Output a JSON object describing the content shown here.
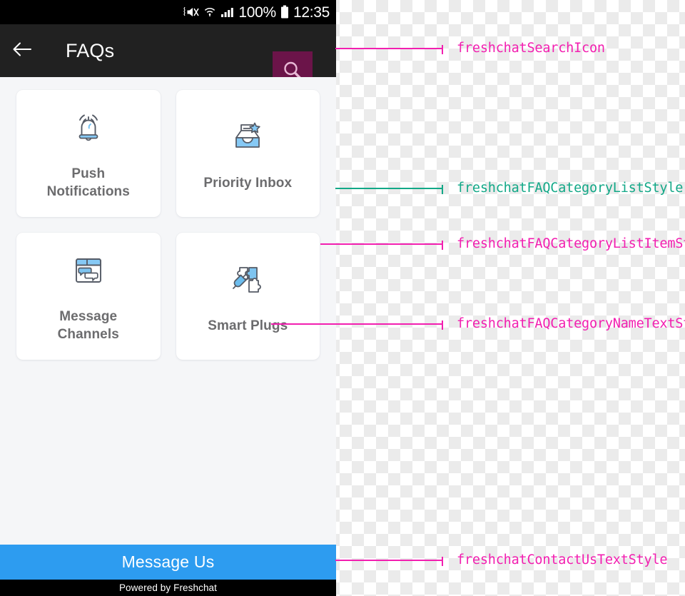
{
  "status_bar": {
    "icons": [
      "vibrate-mute-icon",
      "wifi-icon",
      "signal-icon",
      "battery-icon"
    ],
    "battery_percent": "100%",
    "time": "12:35"
  },
  "app_bar": {
    "back_icon": "arrow-left-icon",
    "title": "FAQs",
    "search_icon": "search-icon",
    "search_highlight_color": "#6B1449",
    "background_color": "#212121"
  },
  "categories": [
    {
      "icon": "bell-notification-icon",
      "name": "Push\nNotifications"
    },
    {
      "icon": "inbox-star-icon",
      "name": "Priority Inbox"
    },
    {
      "icon": "chat-window-icon",
      "name": "Message\nChannels"
    },
    {
      "icon": "puzzle-plug-icon",
      "name": "Smart Plugs"
    }
  ],
  "bottom": {
    "message_us_label": "Message Us",
    "message_us_color": "#2D9CF0",
    "powered_by_label": "Powered by Freshchat"
  },
  "annotations": [
    {
      "label": "freshchatSearchIcon",
      "color": "#F21FB0"
    },
    {
      "label": "freshchatFAQCategoryListStyle",
      "color": "#12A887"
    },
    {
      "label": "freshchatFAQCategoryListItemStyle",
      "color": "#F21FB0"
    },
    {
      "label": "freshchatFAQCategoryNameTextStyle",
      "color": "#F21FB0"
    },
    {
      "label": "freshchatContactUsTextStyle",
      "color": "#F21FB0"
    }
  ]
}
